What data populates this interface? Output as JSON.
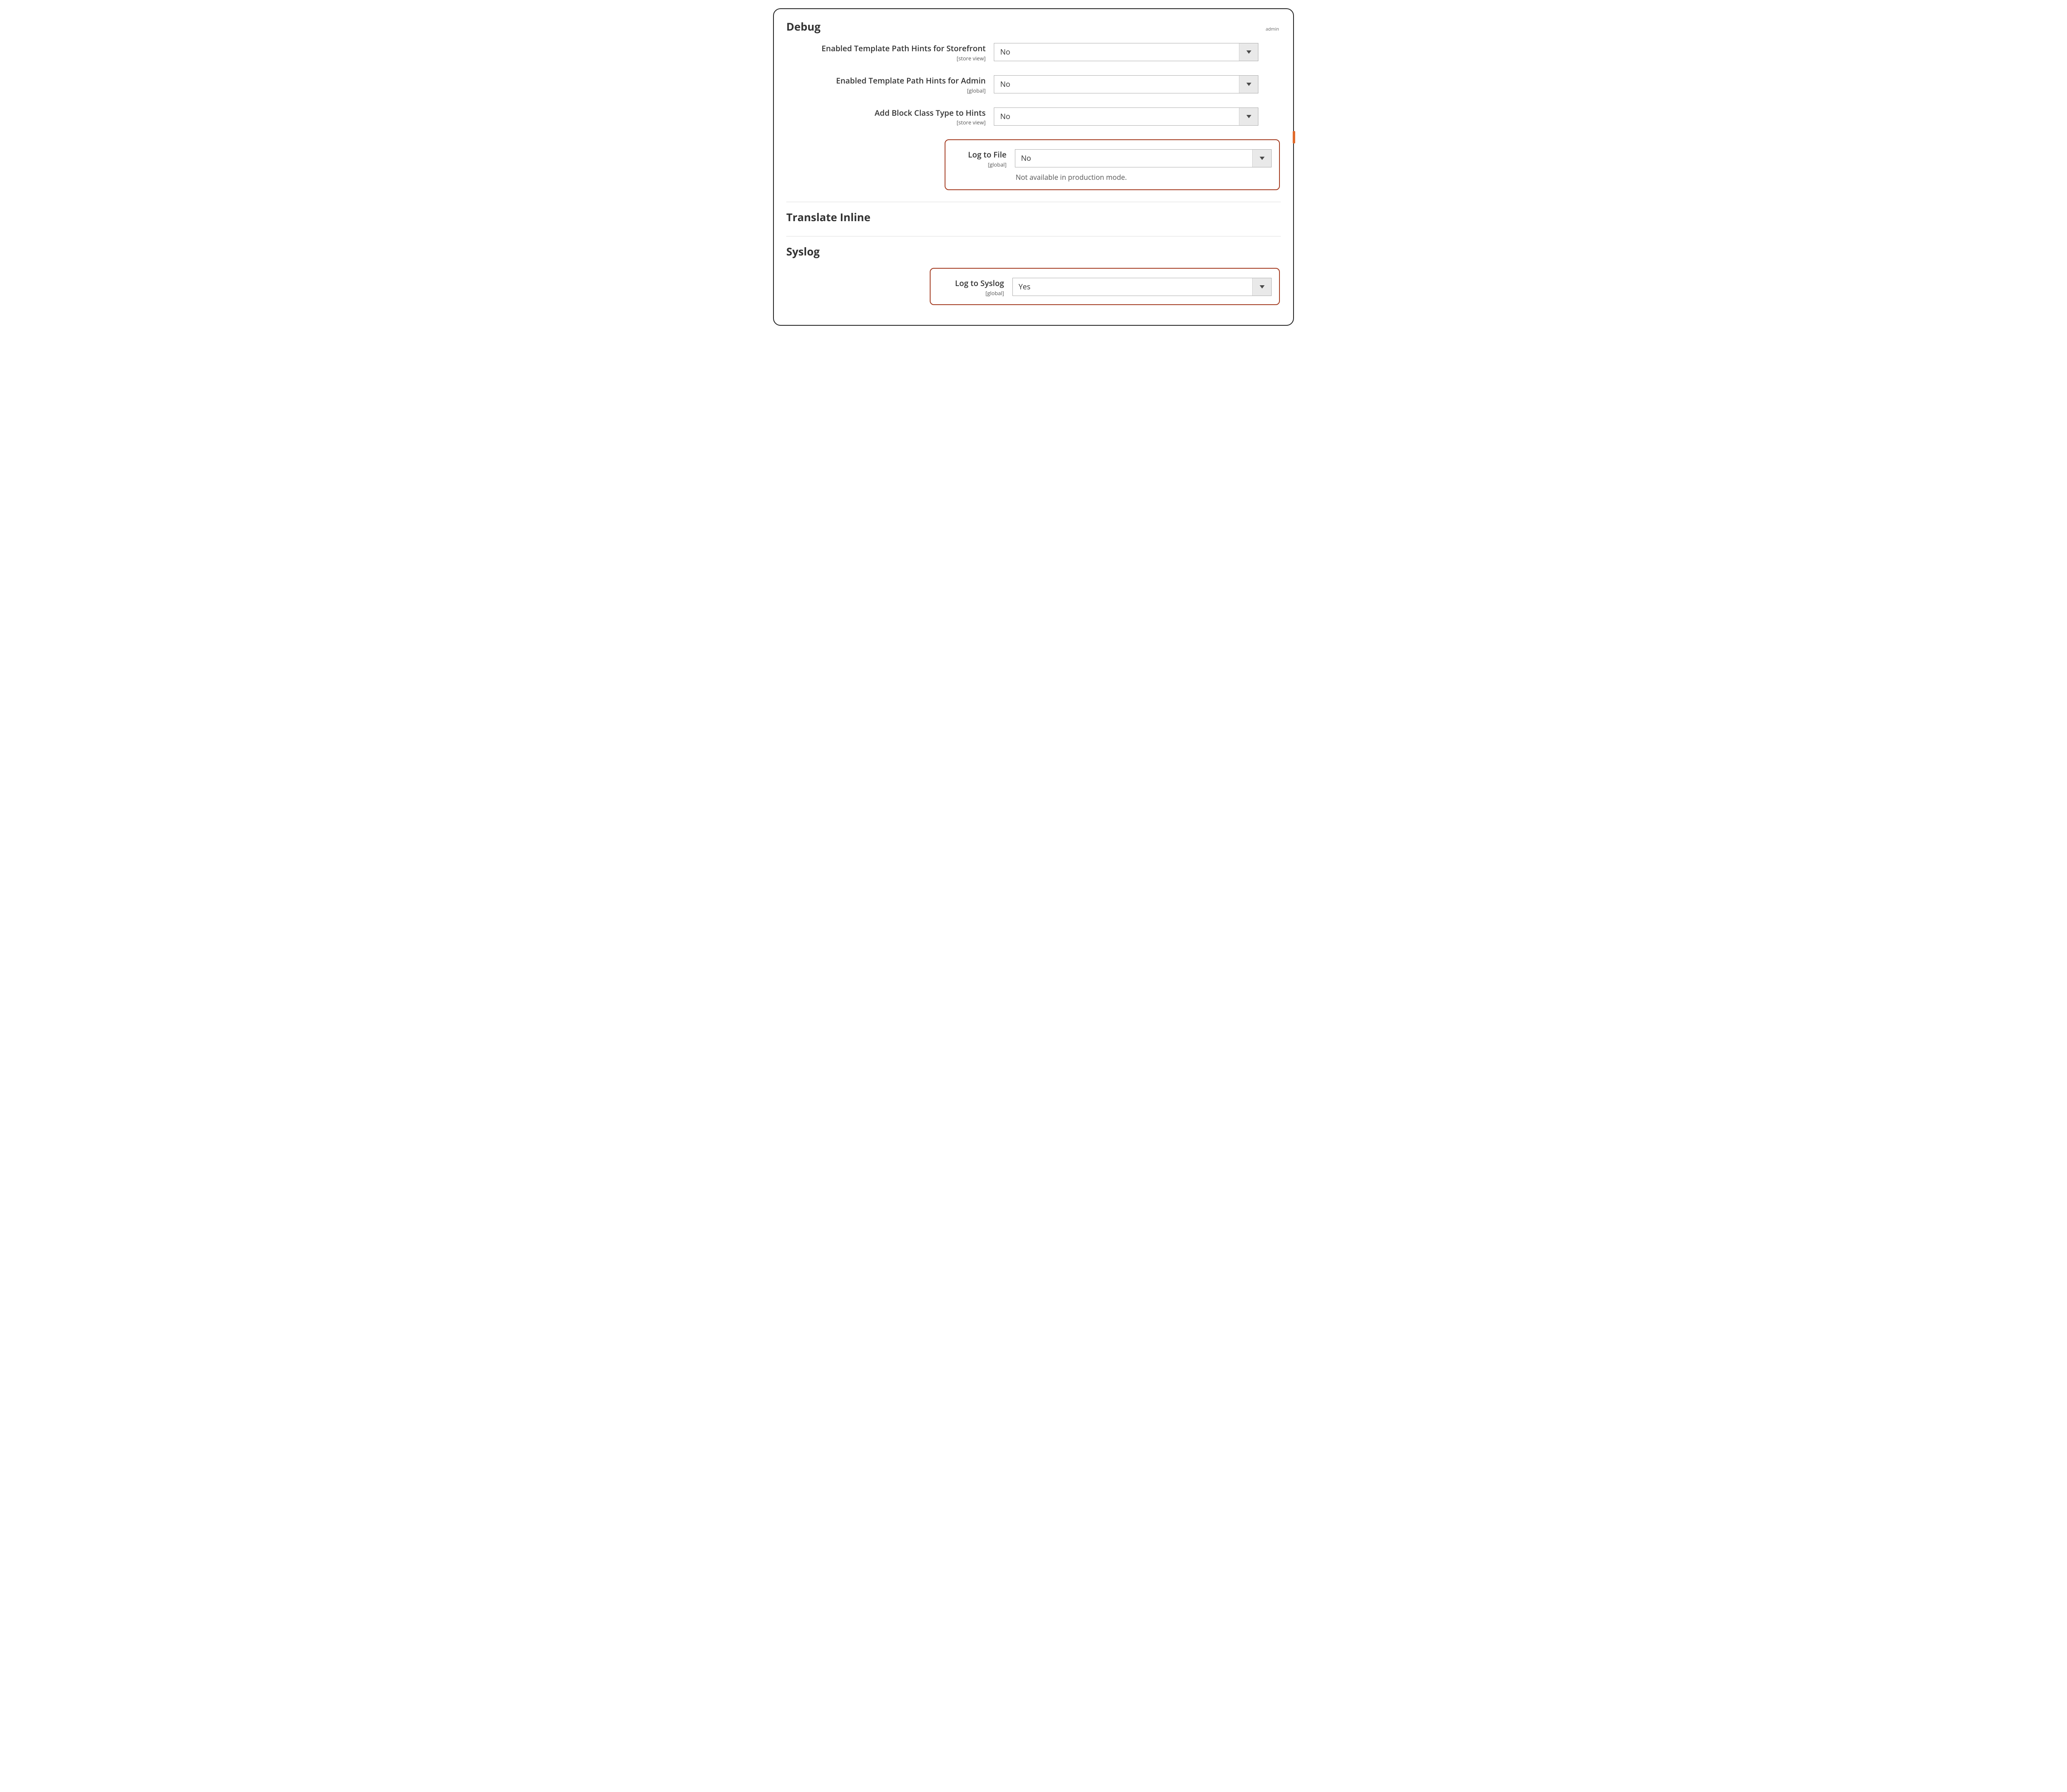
{
  "header": {
    "admin_tag": "admin"
  },
  "sections": {
    "debug": {
      "title": "Debug",
      "fields": {
        "hints_storefront": {
          "label": "Enabled Template Path Hints for Storefront",
          "scope": "[store view]",
          "value": "No"
        },
        "hints_admin": {
          "label": "Enabled Template Path Hints for Admin",
          "scope": "[global]",
          "value": "No"
        },
        "block_class": {
          "label": "Add Block Class Type to Hints",
          "scope": "[store view]",
          "value": "No"
        },
        "log_to_file": {
          "label": "Log to File",
          "scope": "[global]",
          "value": "No",
          "note": "Not available in production mode."
        }
      }
    },
    "translate_inline": {
      "title": "Translate Inline"
    },
    "syslog": {
      "title": "Syslog",
      "fields": {
        "log_to_syslog": {
          "label": "Log to Syslog",
          "scope": "[global]",
          "value": "Yes"
        }
      }
    }
  }
}
